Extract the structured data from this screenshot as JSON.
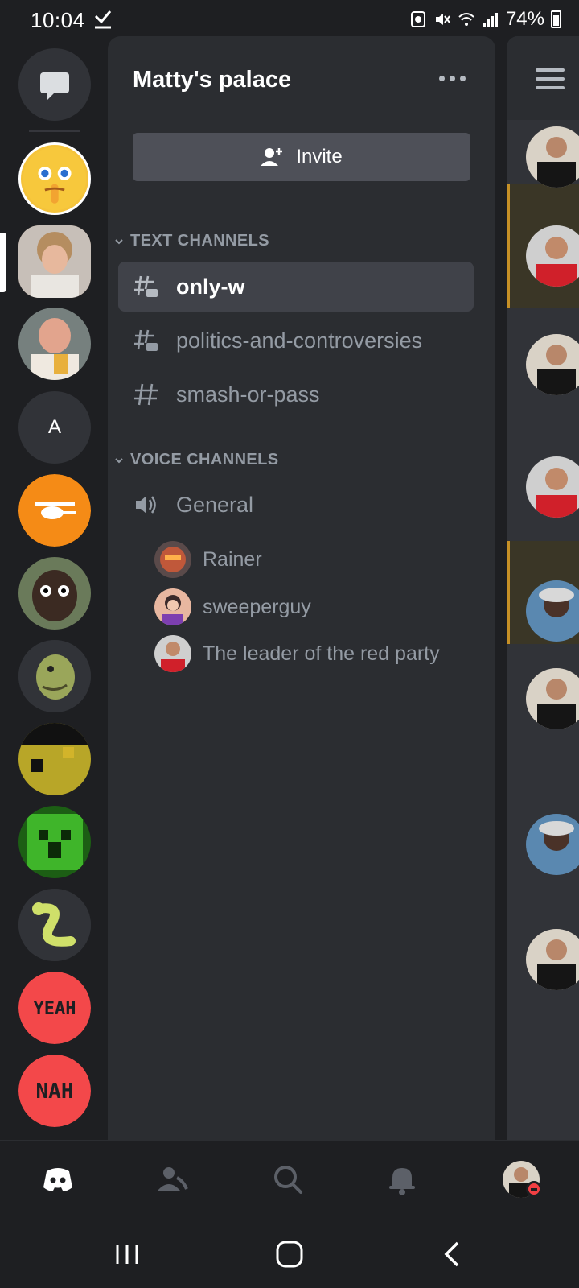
{
  "status_bar": {
    "time": "10:04",
    "battery": "74%"
  },
  "server": {
    "name": "Matty's palace",
    "invite_label": "Invite",
    "letter_server": "A"
  },
  "categories": {
    "text": "TEXT CHANNELS",
    "voice": "VOICE CHANNELS"
  },
  "text_channels": [
    {
      "name": "only-w",
      "active": true
    },
    {
      "name": "politics-and-controversies",
      "active": false
    },
    {
      "name": "smash-or-pass",
      "active": false
    }
  ],
  "voice_channels": [
    {
      "name": "General"
    }
  ],
  "voice_users": [
    {
      "name": "Rainer"
    },
    {
      "name": "sweeperguy"
    },
    {
      "name": "The leader of the red party"
    }
  ],
  "bottom_nav": [
    "home-icon",
    "friends-icon",
    "search-icon",
    "notifications-icon",
    "profile-avatar"
  ],
  "colors": {
    "background": "#1e1f22",
    "panel": "#2b2d31",
    "active_channel": "#404249",
    "muted_text": "#949ba4",
    "highlight": "#c69026",
    "dnd": "#f23f43"
  }
}
